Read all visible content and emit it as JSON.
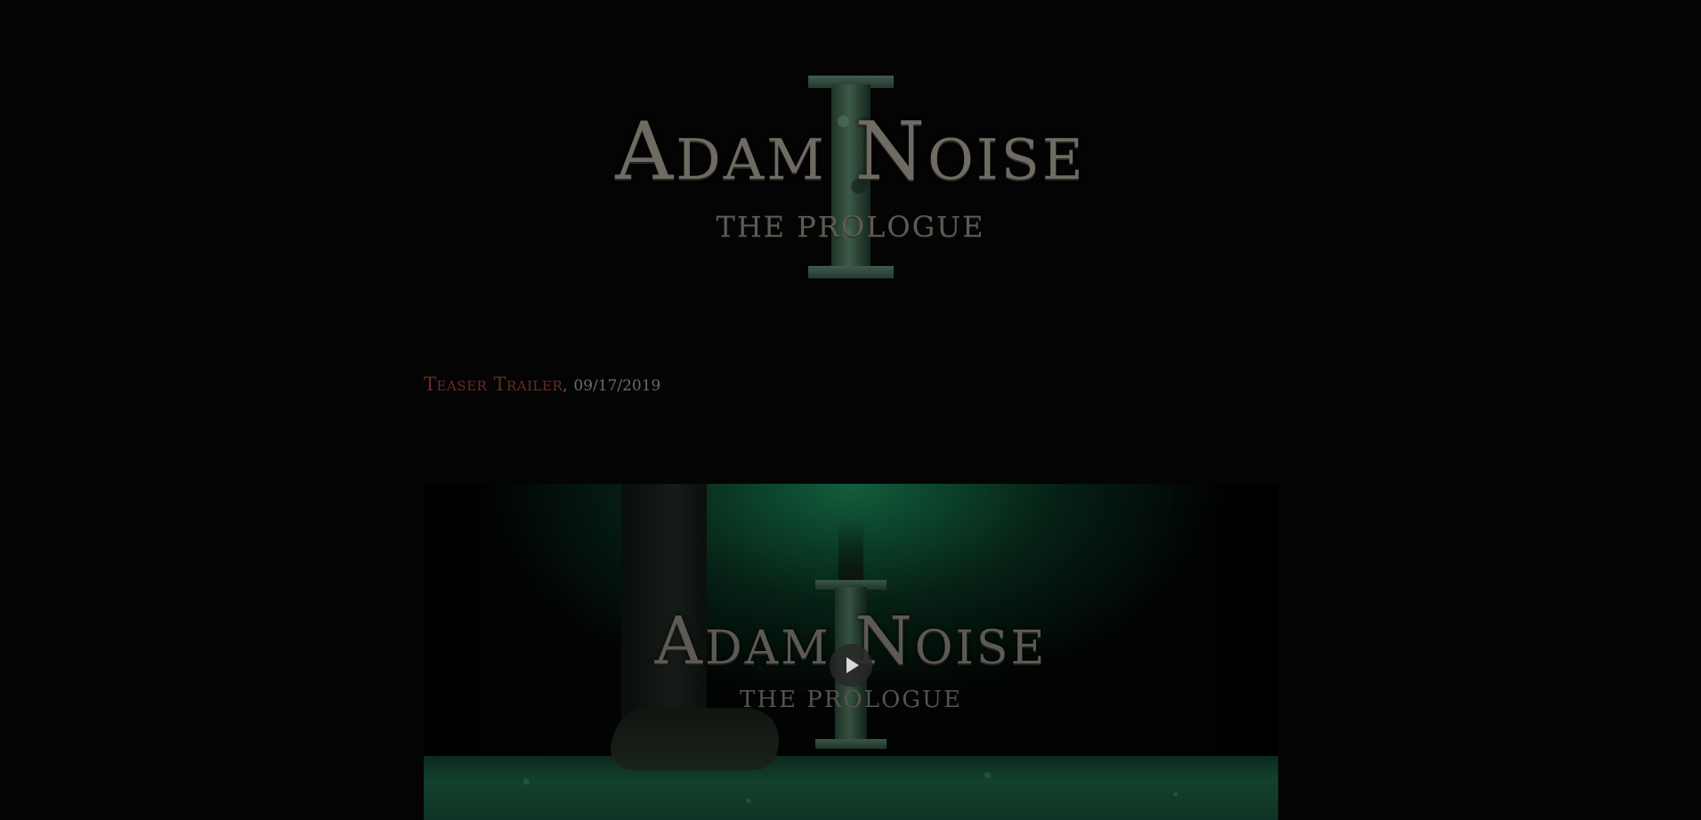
{
  "header": {
    "logo_title": "Adam Noise",
    "logo_subtitle": "THE PROLOGUE"
  },
  "trailer": {
    "label": "Teaser Trailer",
    "separator": ",",
    "date": "09/17/2019"
  },
  "video": {
    "title": "Adam Noise",
    "subtitle": "THE PROLOGUE",
    "play_icon": "play-icon"
  },
  "colors": {
    "background": "#040404",
    "label_red": "#6b2b24",
    "logo_gray": "#6f6b63",
    "accent_green": "#1b6e46"
  }
}
